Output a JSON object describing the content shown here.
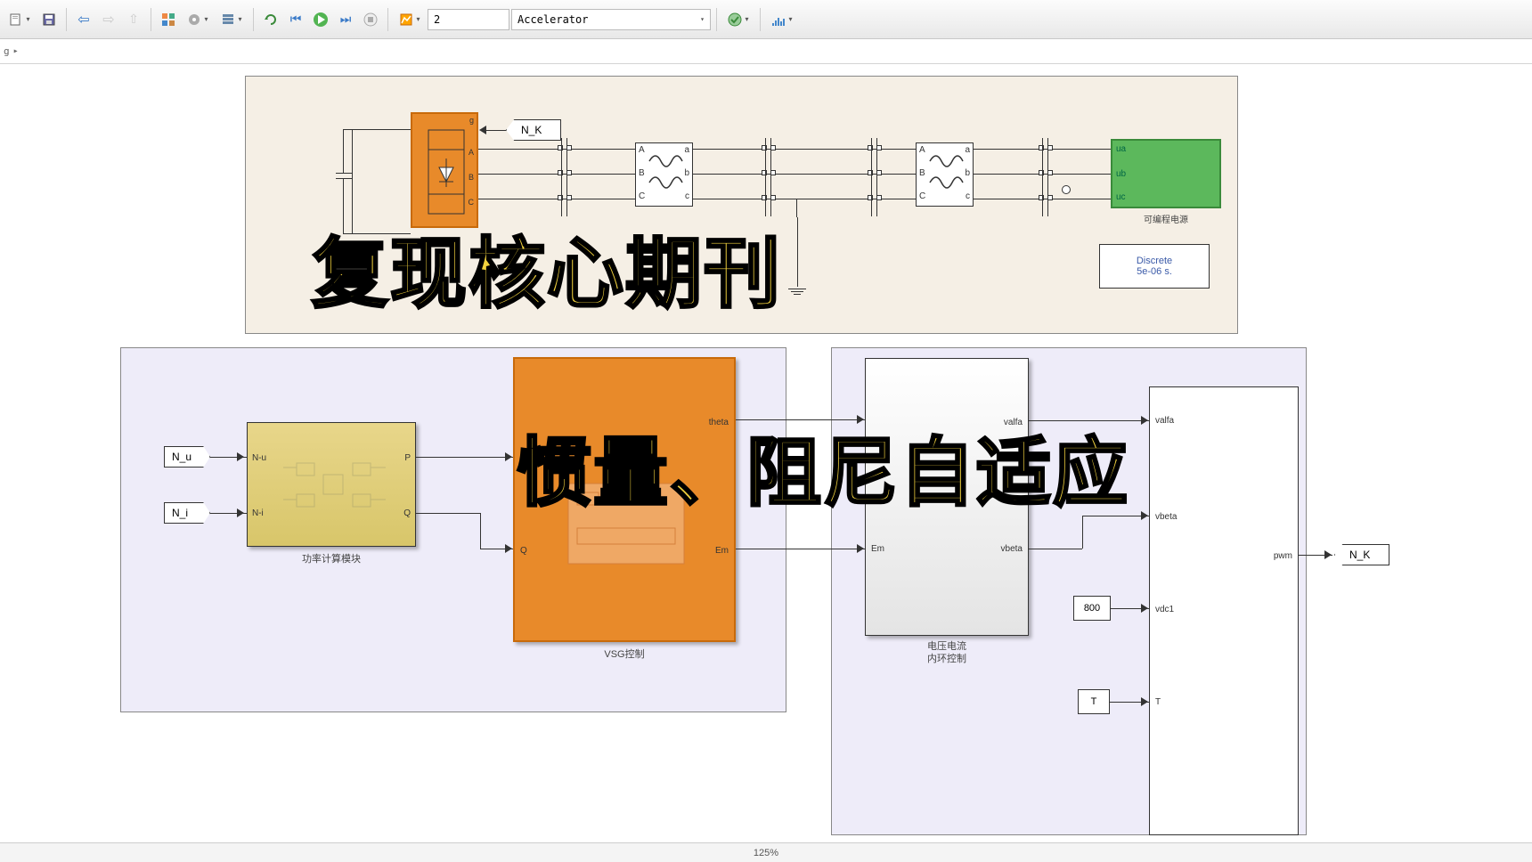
{
  "toolbar": {
    "stop_time": "2",
    "mode": "Accelerator"
  },
  "breadcrumb": {
    "item": "g"
  },
  "blocks": {
    "nk_from": "N_K",
    "prog_source_label": "可编程电源",
    "prog_source_ports": {
      "ua": "ua",
      "ub": "ub",
      "uc": "uc"
    },
    "powergui_l1": "Discrete",
    "powergui_l2": "5e-06 s.",
    "nu_from": "N_u",
    "ni_from": "N_i",
    "power_calc": {
      "label": "功率计算模块",
      "in_u": "N-u",
      "in_i": "N-i",
      "out_p": "P",
      "out_q": "Q"
    },
    "vsg": {
      "label": "VSG控制",
      "in_p": "P",
      "in_q": "Q",
      "out1": "theta",
      "out2": "Em"
    },
    "vi_loop": {
      "label": "电压电流\n内环控制",
      "in_em": "Em",
      "out1": "valfa",
      "out2": "vbeta"
    },
    "pwm_block": {
      "in1": "vbeta",
      "in2": "vdc1",
      "in3": "T",
      "in0": "valfa",
      "out": "pwm"
    },
    "const800": "800",
    "constT": "T",
    "nk_goto": "N_K",
    "filterABC": {
      "a": "A",
      "b": "B",
      "c": "C",
      "a2": "a",
      "b2": "b",
      "c2": "c"
    }
  },
  "overlays": {
    "t1": "复现核心期刊",
    "t2": "惯量、阻尼自适应"
  },
  "status": {
    "zoom": "125%"
  }
}
